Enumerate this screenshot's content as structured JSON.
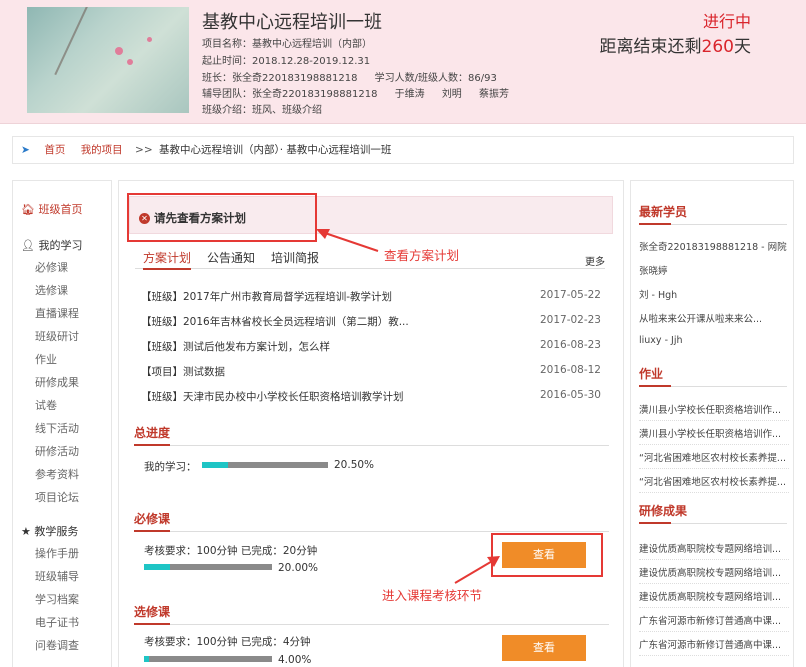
{
  "header": {
    "class_title": "基教中心远程培训一班",
    "project_name": "项目名称：基教中心远程培训（内部）",
    "period": "起止时间：2018.12.28-2019.12.31",
    "monitor": "班长：张全奇220183198881218",
    "student_count": "学习人数/班级人数：86/93",
    "tutors_label": "辅导团队：张全奇220183198881218",
    "tutor_names": [
      "于维涛",
      "刘明",
      "蔡振芳"
    ],
    "intro": "班级介绍：班风、班级介绍",
    "status": "进行中",
    "countdown_prefix": "距离结束还剩",
    "countdown_days": "260",
    "countdown_suffix": "天"
  },
  "breadcrumb": {
    "home": "首页",
    "my_projects": "我的项目",
    "sep": ">>",
    "path": "基教中心远程培训（内部）· 基教中心远程培训一班"
  },
  "sidebar": {
    "class_home": "班级首页",
    "my_learning": "我的学习",
    "learning_items": [
      "必修课",
      "选修课",
      "直播课程",
      "班级研讨",
      "作业",
      "研修成果",
      "试卷",
      "线下活动",
      "研修活动",
      "参考资料",
      "项目论坛"
    ],
    "teaching_services": "教学服务",
    "service_items": [
      "操作手册",
      "班级辅导",
      "学习档案",
      "电子证书",
      "问卷调查"
    ]
  },
  "main": {
    "alert": "请先查看方案计划",
    "tabs": [
      "方案计划",
      "公告通知",
      "培训简报"
    ],
    "more": "更多",
    "news": [
      {
        "title": "【班级】2017年广州市教育局督学远程培训-教学计划",
        "date": "2017-05-22"
      },
      {
        "title": "【班级】2016年吉林省校长全员远程培训（第二期）教...",
        "date": "2017-02-23"
      },
      {
        "title": "【班级】测试后他发布方案计划，怎么样",
        "date": "2016-08-23"
      },
      {
        "title": "【项目】测试数据",
        "date": "2016-08-12"
      },
      {
        "title": "【班级】天津市民办校中小学校长任职资格培训教学计划",
        "date": "2016-05-30"
      }
    ],
    "total": {
      "title": "总进度",
      "label": "我的学习：",
      "pct_text": "20.50%",
      "pct": 20.5
    },
    "required": {
      "title": "必修课",
      "req": "考核要求：100分钟 已完成：20分钟",
      "pct_text": "20.00%",
      "pct": 20,
      "button": "查看"
    },
    "elective": {
      "title": "选修课",
      "req": "考核要求：100分钟 已完成：4分钟",
      "pct_text": "4.00%",
      "pct": 4,
      "button": "查看"
    }
  },
  "annotations": {
    "view_plan": "查看方案计划",
    "enter_course": "进入课程考核环节"
  },
  "right": {
    "new_students_title": "最新学员",
    "new_students": [
      "张全奇220183198881218 - 网院",
      "张晓婷",
      "刘 - Hgh",
      "从啦来来公开课从啦来来公...",
      "liuxy - Jjh"
    ],
    "homework_title": "作业",
    "homework": [
      "潢川县小学校长任职资格培训作...",
      "潢川县小学校长任职资格培训作...",
      "“河北省困难地区农村校长素养提...",
      "“河北省困难地区农村校长素养提..."
    ],
    "results_title": "研修成果",
    "results": [
      "建设优质高职院校专题网络培训...",
      "建设优质高职院校专题网络培训...",
      "建设优质高职院校专题网络培训...",
      "广东省河源市新修订普通高中课...",
      "广东省河源市新修订普通高中课..."
    ]
  },
  "colors": {
    "accent": "#c0392b",
    "annotation": "#e53935",
    "button": "#f08c28",
    "progress": "#1ec5c5"
  }
}
